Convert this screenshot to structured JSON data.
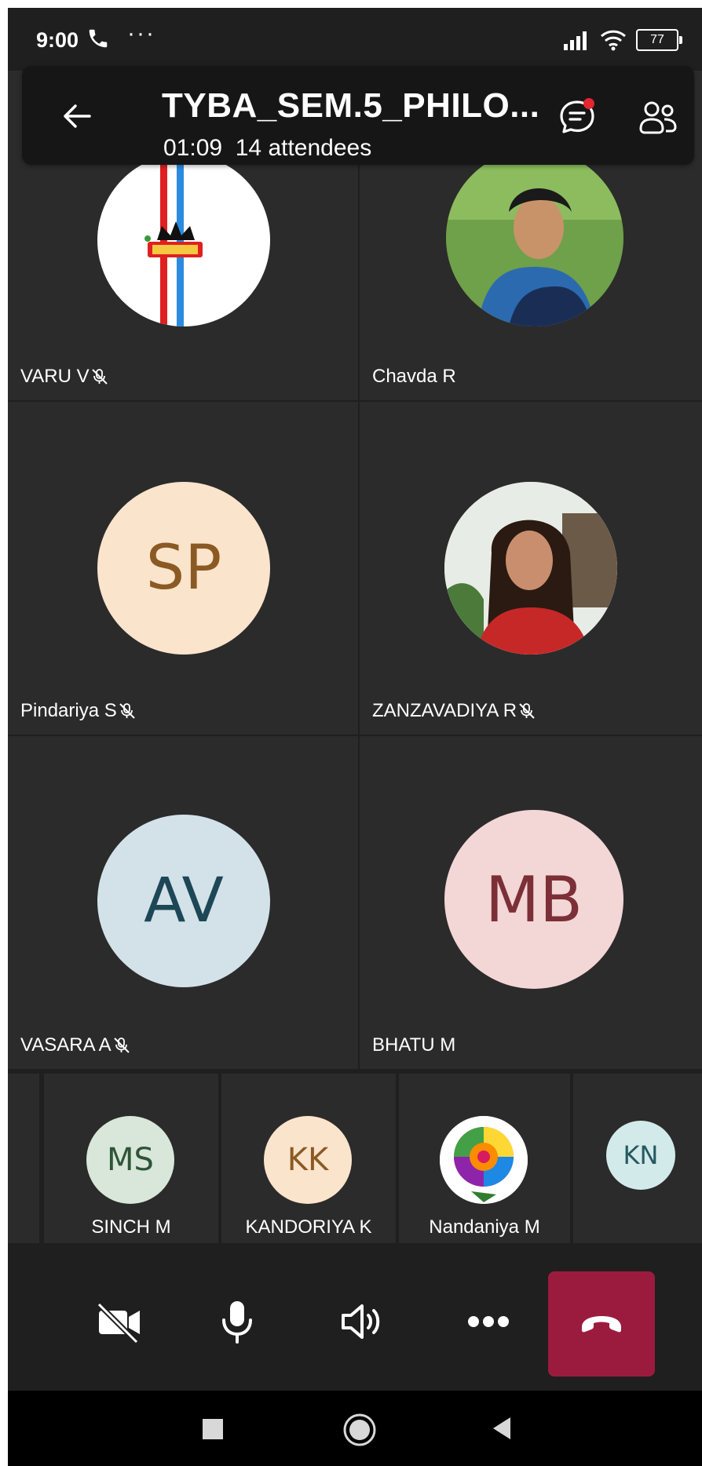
{
  "status_bar": {
    "time": "9:00",
    "dots": "···",
    "battery": "77"
  },
  "header": {
    "title": "TYBA_SEM.5_PHILO...",
    "duration": "01:09",
    "attendees": "14 attendees"
  },
  "participants": [
    {
      "name": "VARU V",
      "muted": true
    },
    {
      "name": "Chavda R",
      "muted": false
    },
    {
      "name": "Pindariya S",
      "initials": "SP",
      "muted": true
    },
    {
      "name": "ZANZAVADIYA R",
      "muted": true
    },
    {
      "name": "VASARA A",
      "initials": "AV",
      "muted": true
    },
    {
      "name": "BHATU M",
      "initials": "MB",
      "muted": false
    }
  ],
  "strip": [
    {
      "name": "SINCH M",
      "initials": "MS"
    },
    {
      "name": "KANDORIYA K",
      "initials": "KK"
    },
    {
      "name": "Nandaniya M"
    },
    {
      "name": "",
      "initials": "KN"
    }
  ],
  "colors": {
    "sp_bg": "#fbe4cc",
    "sp_fg": "#8b5a24",
    "av_bg": "#d3e2e8",
    "av_fg": "#1d4756",
    "mb_bg": "#f3d6d6",
    "mb_fg": "#7c2f37",
    "ms_bg": "#d8e7d9",
    "ms_fg": "#2f5438",
    "kk_bg": "#fbe4cc",
    "kk_fg": "#8b5a24",
    "kn_bg": "#d3eaea",
    "kn_fg": "#25595f",
    "end_call": "#9b1b3e"
  }
}
